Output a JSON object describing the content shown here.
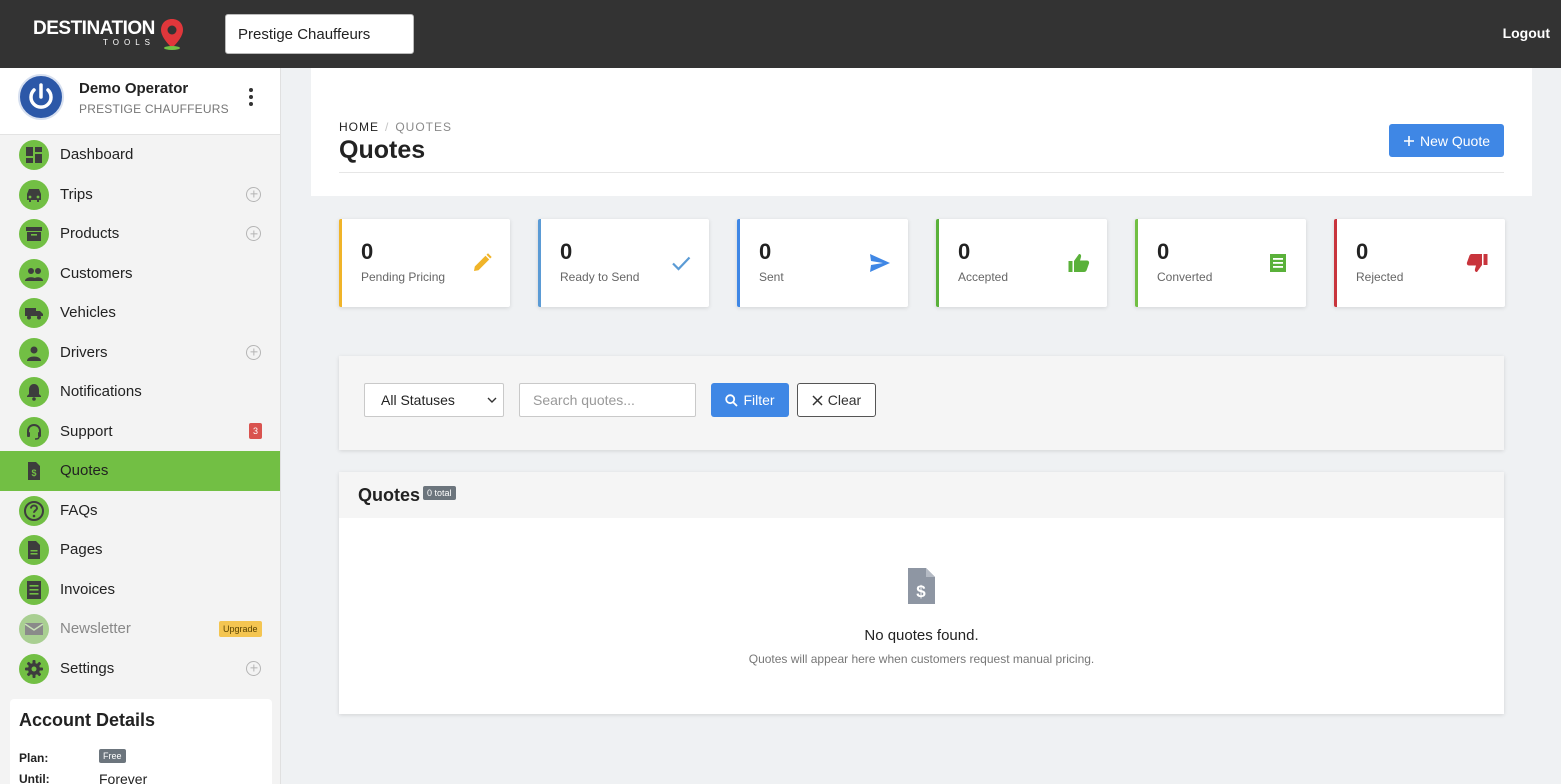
{
  "brand": {
    "name": "DESTINATION",
    "sub": "TOOLS"
  },
  "header": {
    "org_value": "Prestige Chauffeurs",
    "logout_label": "Logout"
  },
  "user": {
    "name": "Demo Operator",
    "org": "PRESTIGE CHAUFFEURS"
  },
  "sidebar": {
    "items": [
      {
        "label": "Dashboard",
        "icon": "dashboard-icon"
      },
      {
        "label": "Trips",
        "icon": "car-icon",
        "plus": true
      },
      {
        "label": "Products",
        "icon": "archive-icon",
        "plus": true
      },
      {
        "label": "Customers",
        "icon": "people-icon"
      },
      {
        "label": "Vehicles",
        "icon": "truck-icon"
      },
      {
        "label": "Drivers",
        "icon": "person-icon",
        "plus": true
      },
      {
        "label": "Notifications",
        "icon": "bell-icon"
      },
      {
        "label": "Support",
        "icon": "headset-icon",
        "badge": "3"
      },
      {
        "label": "Quotes",
        "icon": "invoice-dollar-icon",
        "active": true
      },
      {
        "label": "FAQs",
        "icon": "question-icon"
      },
      {
        "label": "Pages",
        "icon": "document-icon"
      },
      {
        "label": "Invoices",
        "icon": "receipt-icon"
      },
      {
        "label": "Newsletter",
        "icon": "envelope-icon",
        "disabled": true,
        "upgrade": "Upgrade"
      },
      {
        "label": "Settings",
        "icon": "gear-icon",
        "plus": true
      }
    ]
  },
  "account": {
    "title": "Account Details",
    "plan_label": "Plan:",
    "plan_value": "Free",
    "until_label": "Until:",
    "until_value": "Forever"
  },
  "page": {
    "breadcrumb_home": "HOME",
    "breadcrumb_current": "QUOTES",
    "title": "Quotes",
    "new_quote_label": "New Quote"
  },
  "stats": [
    {
      "value": "0",
      "label": "Pending Pricing",
      "color": "#f0b429",
      "icon": "pencil-icon"
    },
    {
      "value": "0",
      "label": "Ready to Send",
      "color": "#5b9bd5",
      "icon": "check-icon"
    },
    {
      "value": "0",
      "label": "Sent",
      "color": "#3f87e5",
      "icon": "send-icon"
    },
    {
      "value": "0",
      "label": "Accepted",
      "color": "#5ab13a",
      "icon": "thumbs-up-icon"
    },
    {
      "value": "0",
      "label": "Converted",
      "color": "#72bf44",
      "icon": "receipt-icon"
    },
    {
      "value": "0",
      "label": "Rejected",
      "color": "#c8343c",
      "icon": "thumbs-down-icon"
    }
  ],
  "filters": {
    "status_selected": "All Statuses",
    "search_placeholder": "Search quotes...",
    "filter_label": "Filter",
    "clear_label": "Clear"
  },
  "quotes": {
    "title": "Quotes",
    "total_badge": "0 total",
    "empty_title": "No quotes found.",
    "empty_subtitle": "Quotes will appear here when customers request manual pricing."
  },
  "colors": {
    "topbar": "#333333",
    "accent_green": "#72bf44",
    "primary_blue": "#3f87e5"
  }
}
